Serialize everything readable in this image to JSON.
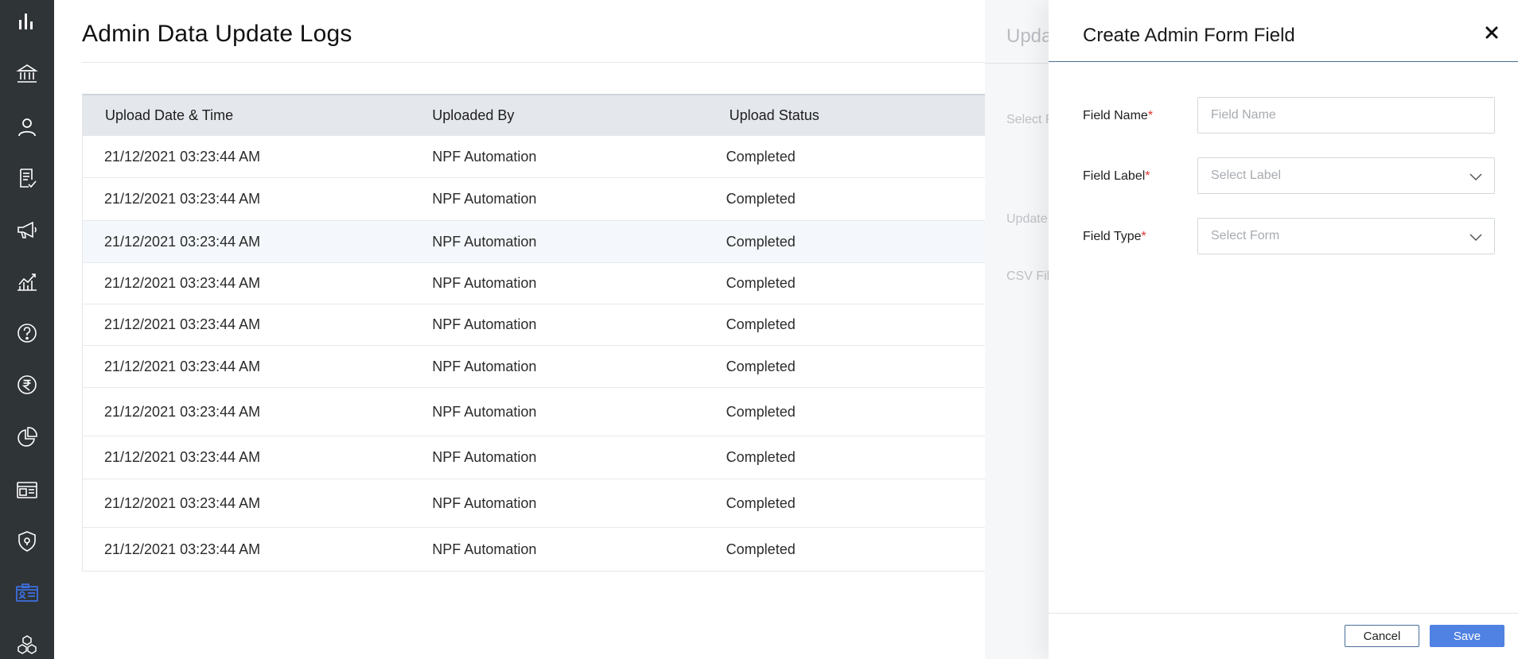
{
  "sidebar": {
    "items": [
      {
        "icon": "bar-chart-icon"
      },
      {
        "icon": "bank-icon"
      },
      {
        "icon": "user-icon"
      },
      {
        "icon": "checklist-icon"
      },
      {
        "icon": "megaphone-icon"
      },
      {
        "icon": "line-chart-icon"
      },
      {
        "icon": "help-icon"
      },
      {
        "icon": "rupee-icon"
      },
      {
        "icon": "pie-chart-icon"
      },
      {
        "icon": "browser-window-icon"
      },
      {
        "icon": "shield-icon"
      },
      {
        "icon": "id-card-icon",
        "active": true
      },
      {
        "icon": "cubes-icon"
      }
    ],
    "active_color": "#3d6fe0",
    "bg_color": "#2f3437"
  },
  "page": {
    "title": "Admin Data Update Logs"
  },
  "table": {
    "headers": [
      "Upload Date & Time",
      "Uploaded By",
      "Upload Status"
    ],
    "rows": [
      [
        "21/12/2021 03:23:44 AM",
        "NPF Automation",
        "Completed"
      ],
      [
        "21/12/2021 03:23:44 AM",
        "NPF Automation",
        "Completed"
      ],
      [
        "21/12/2021 03:23:44 AM",
        "NPF Automation",
        "Completed"
      ],
      [
        "21/12/2021 03:23:44 AM",
        "NPF Automation",
        "Completed"
      ],
      [
        "21/12/2021 03:23:44 AM",
        "NPF Automation",
        "Completed"
      ],
      [
        "21/12/2021 03:23:44 AM",
        "NPF Automation",
        "Completed"
      ],
      [
        "21/12/2021 03:23:44 AM",
        "NPF Automation",
        "Completed"
      ],
      [
        "21/12/2021 03:23:44 AM",
        "NPF Automation",
        "Completed"
      ],
      [
        "21/12/2021 03:23:44 AM",
        "NPF Automation",
        "Completed"
      ],
      [
        "21/12/2021 03:23:44 AM",
        "NPF Automation",
        "Completed"
      ]
    ]
  },
  "background_panel": {
    "title": "Upda",
    "labels": [
      "Select F",
      "Update",
      "CSV File"
    ]
  },
  "drawer": {
    "title": "Create Admin Form Field",
    "fields": {
      "name": {
        "label": "Field Name",
        "required_mark": "*",
        "placeholder": "Field Name"
      },
      "label": {
        "label": "Field Label",
        "required_mark": "*",
        "placeholder": "Select Label"
      },
      "type": {
        "label": "Field Type",
        "required_mark": "*",
        "placeholder": "Select Form"
      }
    },
    "cancel_label": "Cancel",
    "save_label": "Save"
  }
}
